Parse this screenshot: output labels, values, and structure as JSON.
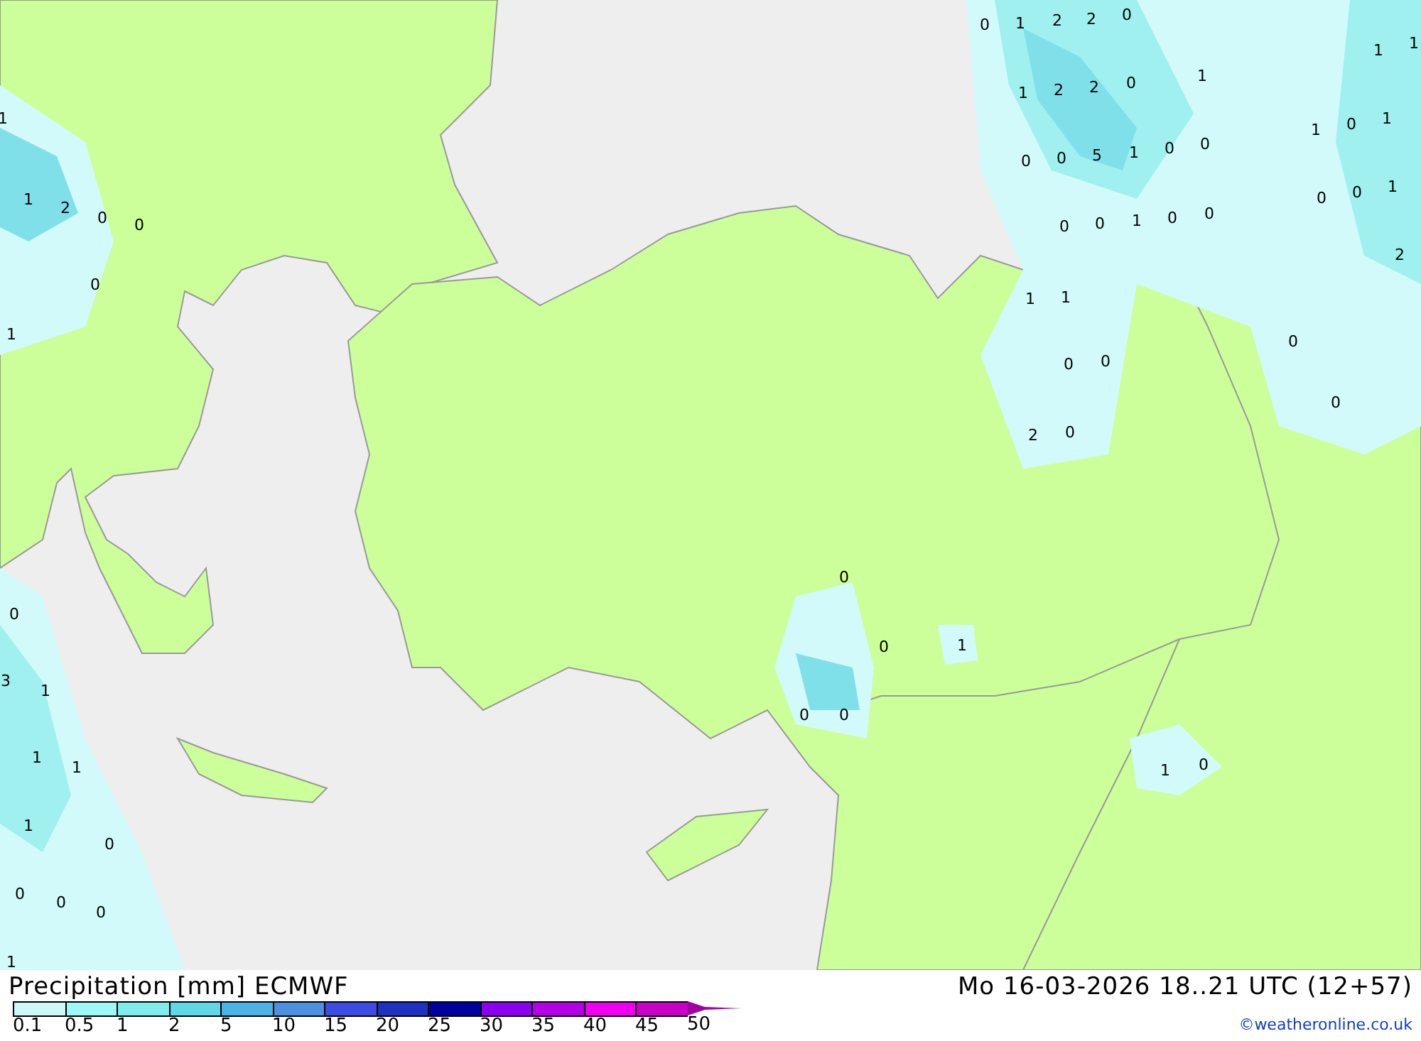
{
  "map_values": [
    "0",
    "1",
    "2",
    "2",
    "0",
    "1",
    "1",
    "1",
    "1",
    "2",
    "2",
    "0",
    "1",
    "0",
    "1",
    "0",
    "0",
    "5",
    "1",
    "0",
    "0",
    "0",
    "0",
    "1",
    "0",
    "0",
    "1",
    "0",
    "0",
    "2",
    "1",
    "1",
    "0",
    "0",
    "0",
    "0",
    "2",
    "0",
    "0",
    "0",
    "1",
    "0",
    "0",
    "1",
    "0",
    "1",
    "1",
    "2",
    "0",
    "0",
    "0",
    "1",
    "0",
    "3",
    "1",
    "1",
    "1",
    "1",
    "0",
    "0",
    "0",
    "0",
    "1"
  ],
  "footer": {
    "title": "Precipitation [mm] ECMWF",
    "valid_time": "Mo 16-03-2026 18..21 UTC (12+57)",
    "credit": "©weatheronline.co.uk",
    "legend": [
      {
        "label": "0.1",
        "color": "#ccf8f8",
        "kind": "swatch"
      },
      {
        "label": "0.5",
        "color": "#9ef8f8",
        "kind": "swatch"
      },
      {
        "label": "1",
        "color": "#80ecec",
        "kind": "swatch"
      },
      {
        "label": "2",
        "color": "#60d8e8",
        "kind": "swatch"
      },
      {
        "label": "5",
        "color": "#4cb4e4",
        "kind": "swatch"
      },
      {
        "label": "10",
        "color": "#4c90e0",
        "kind": "swatch"
      },
      {
        "label": "15",
        "color": "#3c4ce4",
        "kind": "swatch"
      },
      {
        "label": "20",
        "color": "#2030c0",
        "kind": "swatch"
      },
      {
        "label": "25",
        "color": "#0000a0",
        "kind": "swatch"
      },
      {
        "label": "30",
        "color": "#8c00f0",
        "kind": "swatch"
      },
      {
        "label": "35",
        "color": "#b400e4",
        "kind": "swatch"
      },
      {
        "label": "40",
        "color": "#f000f0",
        "kind": "swatch"
      },
      {
        "label": "45",
        "color": "#c800c8",
        "kind": "swatch"
      },
      {
        "label": "50",
        "color": "#a000a0",
        "kind": "arrow"
      }
    ]
  }
}
